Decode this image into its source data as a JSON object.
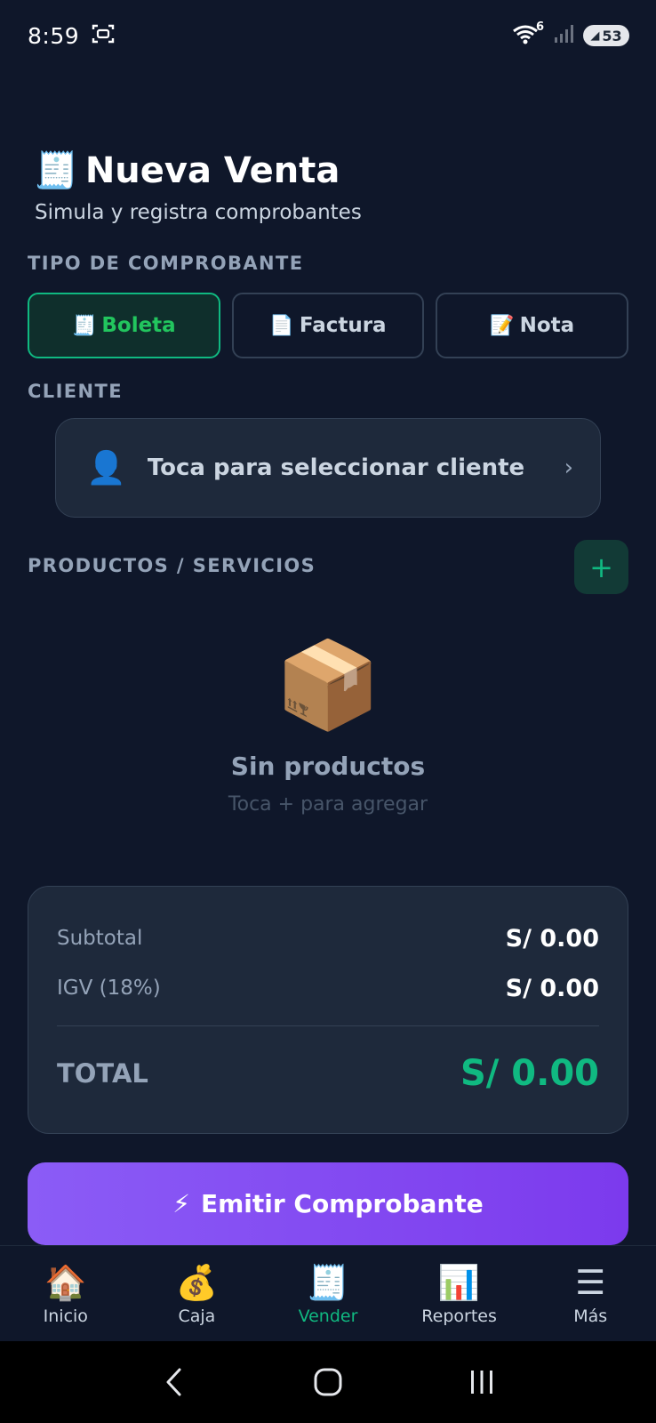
{
  "status_bar": {
    "time": "8:59",
    "wifi_badge": "6",
    "battery": "53"
  },
  "header": {
    "icon": "🧾",
    "title": "Nueva Venta",
    "subtitle": "Simula y registra comprobantes"
  },
  "comprobante": {
    "section_label": "TIPO DE COMPROBANTE",
    "options": [
      {
        "icon": "🧾",
        "label": "Boleta",
        "active": true
      },
      {
        "icon": "📄",
        "label": "Factura",
        "active": false
      },
      {
        "icon": "📝",
        "label": "Nota",
        "active": false
      }
    ]
  },
  "cliente": {
    "section_label": "CLIENTE",
    "avatar_icon": "👤",
    "placeholder": "Toca para seleccionar cliente",
    "chevron": "›"
  },
  "productos": {
    "section_label": "PRODUCTOS / SERVICIOS",
    "add_symbol": "+",
    "empty_icon": "📦",
    "empty_title": "Sin productos",
    "empty_hint": "Toca + para agregar"
  },
  "totals": {
    "subtotal_label": "Subtotal",
    "subtotal_value": "S/ 0.00",
    "igv_label": "IGV (18%)",
    "igv_value": "S/ 0.00",
    "total_label": "TOTAL",
    "total_value": "S/ 0.00"
  },
  "emit_button": {
    "icon": "⚡",
    "label": "Emitir Comprobante"
  },
  "bottom_nav": {
    "items": [
      {
        "icon": "🏠",
        "label": "Inicio",
        "active": false
      },
      {
        "icon": "💰",
        "label": "Caja",
        "active": false
      },
      {
        "icon": "🧾",
        "label": "Vender",
        "active": true
      },
      {
        "icon": "📊",
        "label": "Reportes",
        "active": false
      },
      {
        "icon": "☰",
        "label": "Más",
        "active": false
      }
    ]
  },
  "colors": {
    "background": "#0f172a",
    "card": "#1e293b",
    "accent_green": "#10b981",
    "accent_purple": "#8b5cf6"
  }
}
